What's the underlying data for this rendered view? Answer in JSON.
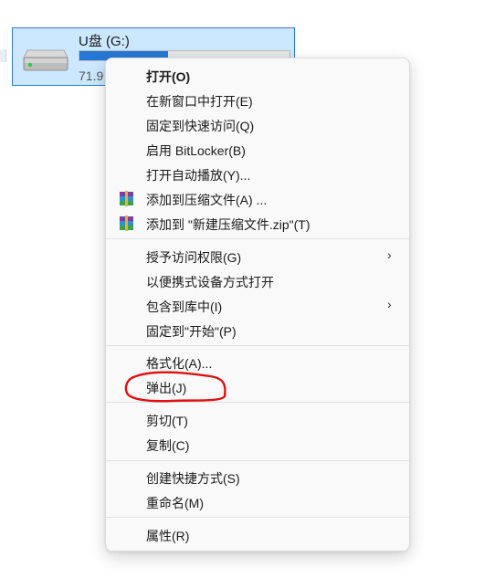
{
  "drive": {
    "name": "U盘 (G:)",
    "free_text": "71.9",
    "usage_fraction": 0.42,
    "bar_color": "#2678d6",
    "icon": "usb-drive-icon"
  },
  "menu": {
    "items": [
      {
        "label": "打开(O)",
        "bold": true
      },
      {
        "label": "在新窗口中打开(E)"
      },
      {
        "label": "固定到快速访问(Q)"
      },
      {
        "label": "启用 BitLocker(B)"
      },
      {
        "label": "打开自动播放(Y)..."
      },
      {
        "label": "添加到压缩文件(A) ...",
        "icon": "winrar-archive-icon"
      },
      {
        "label": "添加到 \"新建压缩文件.zip\"(T)",
        "icon": "winrar-archive-icon"
      },
      {
        "label": "授予访问权限(G)",
        "submenu": true
      },
      {
        "label": "以便携式设备方式打开"
      },
      {
        "label": "包含到库中(I)",
        "submenu": true
      },
      {
        "label": "固定到\"开始\"(P)"
      },
      {
        "label": "格式化(A)..."
      },
      {
        "label": "弹出(J)",
        "highlighted": true
      },
      {
        "label": "剪切(T)"
      },
      {
        "label": "复制(C)"
      },
      {
        "label": "创建快捷方式(S)"
      },
      {
        "label": "重命名(M)"
      },
      {
        "label": "属性(R)"
      }
    ],
    "submenu_glyph": "›"
  },
  "annotation": {
    "color": "#e01010"
  }
}
